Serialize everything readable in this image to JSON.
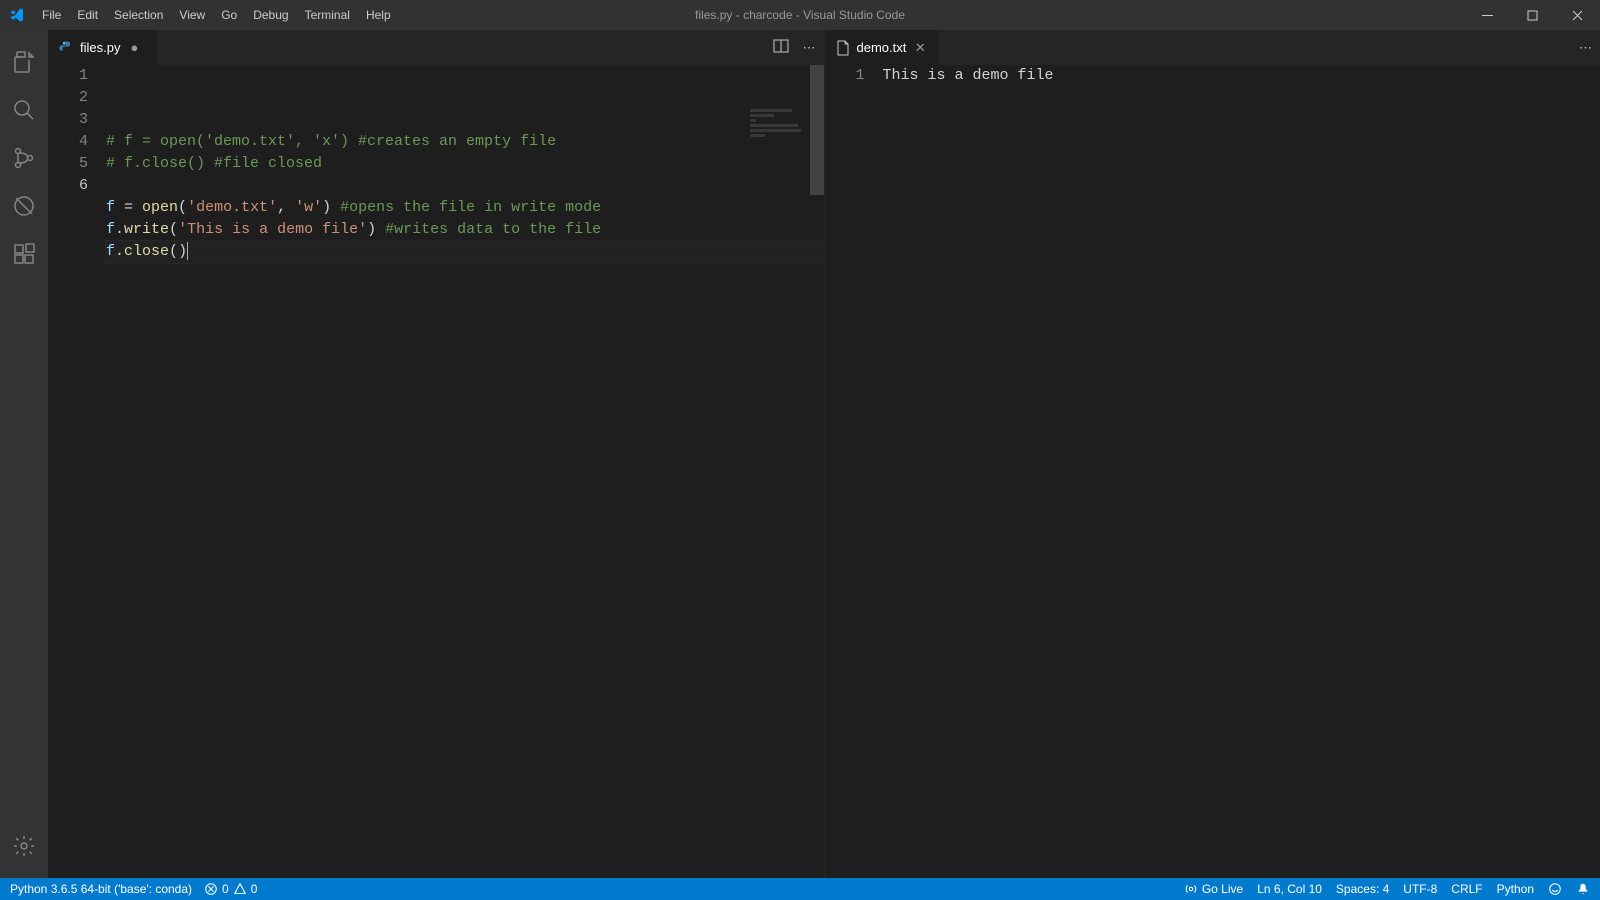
{
  "window": {
    "title": "files.py - charcode - Visual Studio Code"
  },
  "menu": [
    "File",
    "Edit",
    "Selection",
    "View",
    "Go",
    "Debug",
    "Terminal",
    "Help"
  ],
  "activity": {
    "items": [
      "explorer",
      "search",
      "scm",
      "debug",
      "extensions"
    ],
    "bottom": "settings"
  },
  "editors": {
    "left": {
      "tab": {
        "name": "files.py",
        "icon": "python",
        "dirty": true
      },
      "lines": [
        {
          "n": 1,
          "tokens": [
            {
              "t": "# f = open('demo.txt', 'x') #creates an empty file",
              "c": "tok-comment"
            }
          ]
        },
        {
          "n": 2,
          "tokens": [
            {
              "t": "# f.close() #file closed",
              "c": "tok-comment"
            }
          ]
        },
        {
          "n": 3,
          "tokens": []
        },
        {
          "n": 4,
          "tokens": [
            {
              "t": "f",
              "c": "tok-var"
            },
            {
              "t": " = ",
              "c": "tok-op"
            },
            {
              "t": "open",
              "c": "tok-func"
            },
            {
              "t": "(",
              "c": "tok-paren"
            },
            {
              "t": "'demo.txt'",
              "c": "tok-str"
            },
            {
              "t": ", ",
              "c": "tok-op"
            },
            {
              "t": "'w'",
              "c": "tok-str"
            },
            {
              "t": ")",
              "c": "tok-paren"
            },
            {
              "t": " ",
              "c": "tok-op"
            },
            {
              "t": "#opens the file in write mode",
              "c": "tok-comment"
            }
          ]
        },
        {
          "n": 5,
          "tokens": [
            {
              "t": "f",
              "c": "tok-var"
            },
            {
              "t": ".",
              "c": "tok-op"
            },
            {
              "t": "write",
              "c": "tok-func"
            },
            {
              "t": "(",
              "c": "tok-paren"
            },
            {
              "t": "'This is a demo file'",
              "c": "tok-str"
            },
            {
              "t": ")",
              "c": "tok-paren"
            },
            {
              "t": " ",
              "c": "tok-op"
            },
            {
              "t": "#writes data to the file",
              "c": "tok-comment"
            }
          ]
        },
        {
          "n": 6,
          "active": true,
          "cursor": true,
          "tokens": [
            {
              "t": "f",
              "c": "tok-var"
            },
            {
              "t": ".",
              "c": "tok-op"
            },
            {
              "t": "close",
              "c": "tok-func"
            },
            {
              "t": "(",
              "c": "tok-paren"
            },
            {
              "t": ")",
              "c": "tok-paren"
            }
          ]
        }
      ]
    },
    "right": {
      "tab": {
        "name": "demo.txt",
        "icon": "text",
        "dirty": false
      },
      "lines": [
        {
          "n": 1,
          "tokens": [
            {
              "t": "This is a demo file",
              "c": "tok-text"
            }
          ]
        }
      ]
    }
  },
  "status": {
    "left": {
      "python_env": "Python 3.6.5 64-bit ('base': conda)",
      "errors": "0",
      "warnings": "0"
    },
    "right": {
      "go_live": "Go Live",
      "position": "Ln 6, Col 10",
      "spaces": "Spaces: 4",
      "encoding": "UTF-8",
      "eol": "CRLF",
      "language": "Python"
    }
  }
}
